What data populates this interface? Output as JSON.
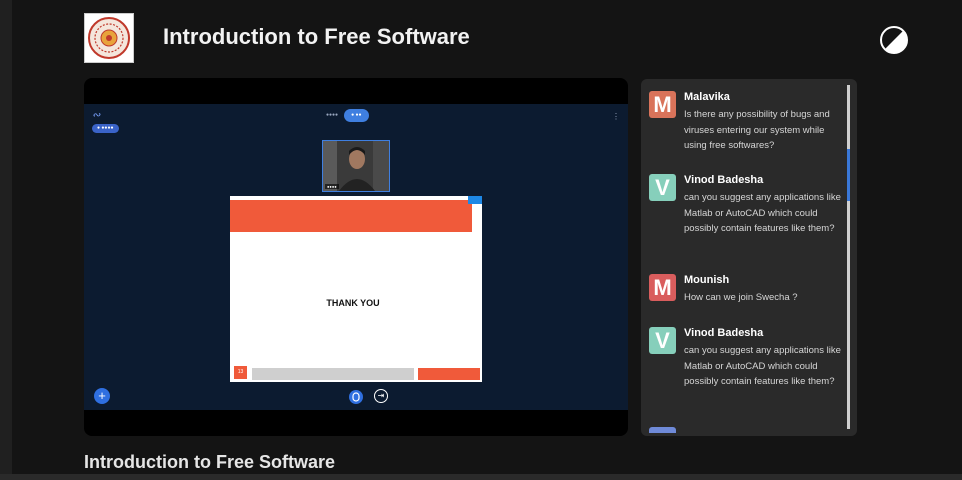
{
  "header": {
    "title": "Introduction to Free Software"
  },
  "video": {
    "slide_text": "THANK YOU",
    "slide_page": "13"
  },
  "chat": {
    "messages": [
      {
        "initial": "M",
        "name": "Malavika",
        "text": "Is there any possibility of bugs and viruses entering our system while using free softwares?",
        "avatar_color": "#d9735a"
      },
      {
        "initial": "V",
        "name": "Vinod Badesha",
        "text": "can you suggest any applications like Matlab or AutoCAD which could possibly contain features like them?",
        "avatar_color": "#86cfbb"
      },
      {
        "initial": "M",
        "name": "Mounish",
        "text": "How can we join Swecha ?",
        "avatar_color": "#d95d5d"
      },
      {
        "initial": "V",
        "name": "Vinod Badesha",
        "text": "can you suggest any applications like Matlab or AutoCAD which could possibly contain features like them?",
        "avatar_color": "#86cfbb"
      }
    ]
  },
  "footer": {
    "title": "Introduction to Free Software"
  },
  "colors": {
    "background": "#141414",
    "chat_panel": "#2a2a2a",
    "meet_background": "#0c1b30",
    "accent": "#f05a3a",
    "scroll_thumb": "#3a78d8"
  },
  "icons": {
    "theme_toggle": "half-circle-contrast-icon",
    "logo": "institution-seal-logo"
  }
}
